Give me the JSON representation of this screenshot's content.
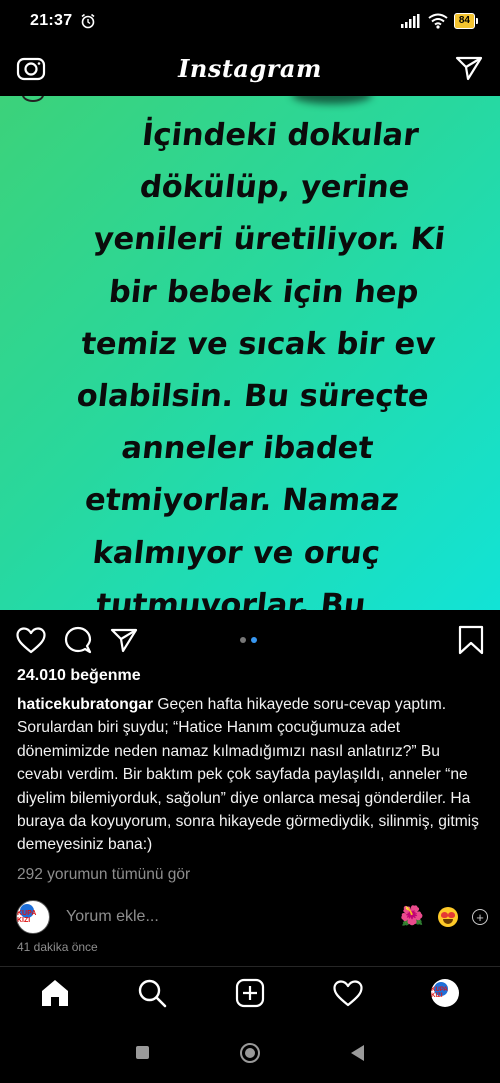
{
  "status_bar": {
    "time": "21:37",
    "battery": "84",
    "icons": [
      "alarm-icon",
      "signal-icon",
      "wifi-icon",
      "battery-icon"
    ]
  },
  "header": {
    "title": "Instagram",
    "left_icon": "camera-icon",
    "right_icon": "direct-message-icon"
  },
  "post": {
    "image_text": "İçindeki dokular\ndökülüp, yerine\nyenileri üretiliyor. Ki\nbir bebek için hep\ntemiz ve sıcak bir ev\nolabilsin. Bu süreçte\nanneler ibadet\netmiyorlar. Namaz\nkalmıyor ve oruç\ntutmuyorlar. Bu\nannelere Allah’ın\nverdiği bir izin...",
    "image_gradient": [
      "#3cd27a",
      "#12e3d6"
    ],
    "carousel": {
      "count": 2,
      "active": 2
    },
    "likes": "24.010 beğenme",
    "username": "haticekubratongar",
    "caption": "Geçen hafta hikayede soru-cevap yaptım. Sorulardan biri şuydu; “Hatice Hanım çocuğumuza adet dönemimizde neden namaz kılmadığımızı nasıl anlatırız?” Bu cevabı verdim. Bir baktım pek çok sayfada paylaşıldı, anneler “ne diyelim bilemiyorduk, sağolun” diye onlarca mesaj gönderdiler. Ha buraya da koyuyorum, sonra hikayede görmediydik, silinmiş, gitmiş demeyesiniz bana:)",
    "view_comments": "292 yorumun tümünü gör",
    "comment_placeholder": "Yorum ekle...",
    "avatar_text": "KUPA KIZI",
    "timestamp": "41 dakika önce",
    "quick_emojis": [
      "🌺",
      "😍",
      "+"
    ]
  },
  "tabbar": {
    "tabs": [
      "home-icon",
      "search-icon",
      "new-post-icon",
      "activity-icon",
      "profile-avatar"
    ],
    "active": "home-icon"
  },
  "colors": {
    "background": "#000000",
    "link_blue": "#3897f0",
    "muted": "#8e8e8e",
    "battery_yellow": "#f4c430"
  }
}
